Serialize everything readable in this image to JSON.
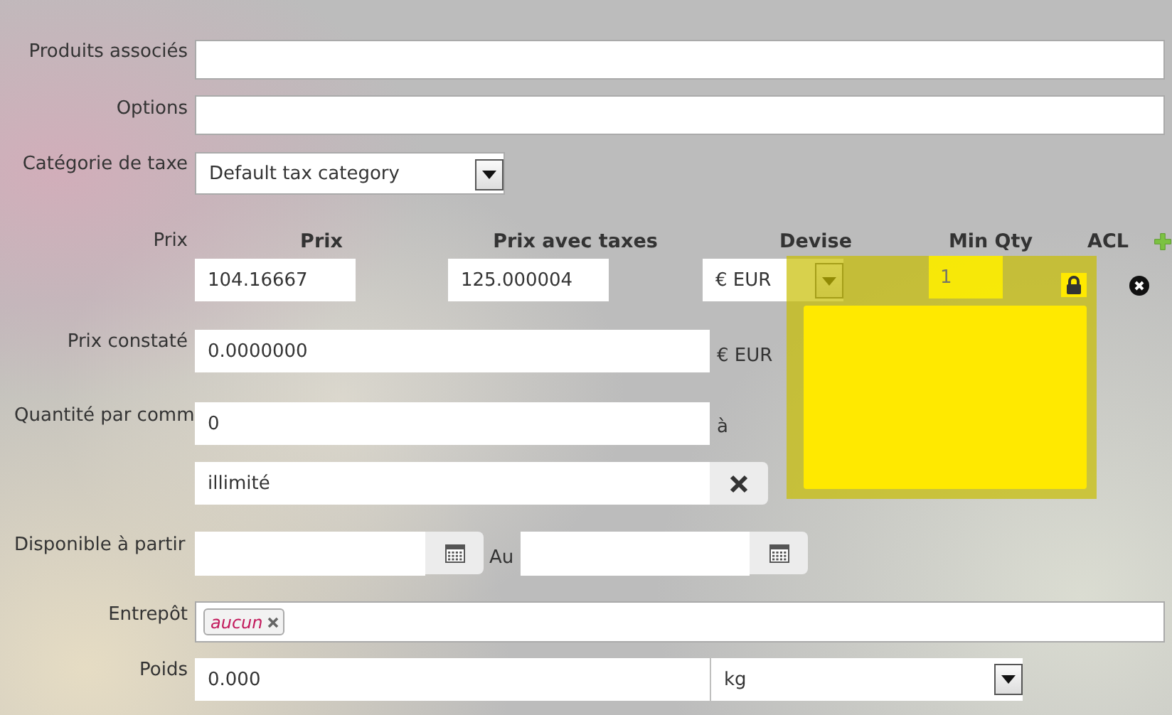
{
  "related_products": {
    "label": "Produits associés"
  },
  "options": {
    "label": "Options"
  },
  "tax_category": {
    "label": "Catégorie de taxe",
    "value": "Default tax category"
  },
  "prices": {
    "label": "Prix",
    "columns": [
      "Prix",
      "Prix avec taxes",
      "Devise",
      "Min Qty",
      "ACL"
    ],
    "rows": [
      {
        "price": "104.16667",
        "price_with_tax": "125.000004",
        "currency": "€ EUR",
        "min_qty": "1"
      }
    ]
  },
  "list_price": {
    "label": "Prix constaté",
    "value": "0.0000000",
    "unit": "€ EUR"
  },
  "quantity": {
    "label": "Quantité par comm",
    "from": "0",
    "between": "à",
    "to": "illimité"
  },
  "availability": {
    "label": "Disponible à partir",
    "between": "Au"
  },
  "warehouse": {
    "label": "Entrepôt",
    "tags": [
      "aucun"
    ]
  },
  "weight": {
    "label": "Poids",
    "value": "0.000",
    "unit": "kg"
  }
}
